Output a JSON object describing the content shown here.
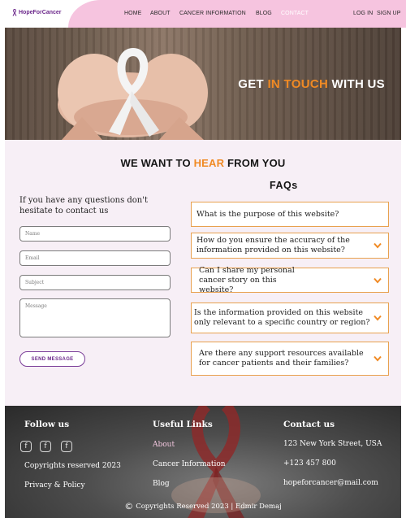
{
  "brand": {
    "name": "HopeForCancer"
  },
  "nav": {
    "links": [
      "HOME",
      "ABOUT",
      "CANCER INFORMATION",
      "BLOG",
      "CONTACT"
    ],
    "active": "CONTACT",
    "login": "LOG IN",
    "signup": "SIGN UP"
  },
  "hero": {
    "title_pre": "GET ",
    "title_accent": "IN TOUCH",
    "title_post": " WITH US"
  },
  "contact": {
    "title_pre": "WE WANT TO ",
    "title_accent": "HEAR",
    "title_post": " FROM YOU",
    "intro": "If you have any questions don't hesitate to contact us",
    "name_placeholder": "Name",
    "email_placeholder": "Email",
    "subject_placeholder": "Subject",
    "message_placeholder": "Message",
    "send_label": "SEND MESSAGE"
  },
  "faq": {
    "title": "FAQs",
    "items": [
      {
        "question": "What is the purpose of this website?",
        "chevron": false
      },
      {
        "question": "How do you ensure the accuracy of the information provided on this website?",
        "chevron": true
      },
      {
        "question": "Can I share my personal cancer story on this website?",
        "chevron": true
      },
      {
        "question": "Is the information provided on this website only relevant to a specific country or region?",
        "chevron": true
      },
      {
        "question": "Are there any support resources available for cancer patients and their families?",
        "chevron": true
      }
    ]
  },
  "footer": {
    "follow_title": "Follow us",
    "social_icons": [
      "facebook-icon",
      "facebook-icon",
      "facebook-icon"
    ],
    "rights": "Copyrights reserved 2023",
    "privacy": "Privacy & Policy",
    "links_title": "Useful Links",
    "links": [
      "About",
      "Cancer Information",
      "Blog"
    ],
    "contact_title": "Contact us",
    "address": "123 New York Street, USA",
    "phone": "+123 457 800",
    "email": "hopeforcancer@mail.com",
    "copyright": "Copyrights Reserved 2023 | Edmir Demaj"
  },
  "colors": {
    "accent": "#f08a24",
    "brand": "#6d2a8c",
    "nav_pink": "#f6c4df",
    "faq_border": "#e8a14f"
  }
}
